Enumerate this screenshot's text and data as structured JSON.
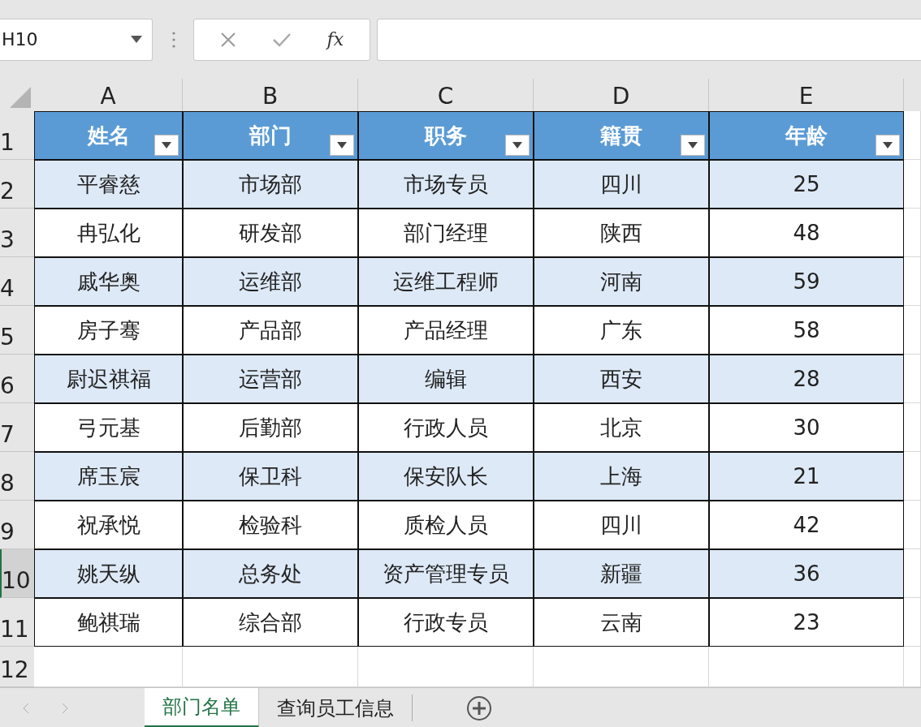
{
  "name_box": {
    "value": "H10"
  },
  "formula_bar": {
    "function_label": "fx"
  },
  "column_headers": [
    "A",
    "B",
    "C",
    "D",
    "E"
  ],
  "row_headers": [
    {
      "label": "1",
      "selected": false
    },
    {
      "label": "2",
      "selected": false
    },
    {
      "label": "3",
      "selected": false
    },
    {
      "label": "4",
      "selected": false
    },
    {
      "label": "5",
      "selected": false
    },
    {
      "label": "6",
      "selected": false
    },
    {
      "label": "7",
      "selected": false
    },
    {
      "label": "8",
      "selected": false
    },
    {
      "label": "9",
      "selected": false
    },
    {
      "label": "10",
      "selected": true
    },
    {
      "label": "11",
      "selected": false
    },
    {
      "label": "12",
      "selected": false
    }
  ],
  "table": {
    "columns": [
      "姓名",
      "部门",
      "职务",
      "籍贯",
      "年龄"
    ],
    "rows": [
      [
        "平睿慈",
        "市场部",
        "市场专员",
        "四川",
        "25"
      ],
      [
        "冉弘化",
        "研发部",
        "部门经理",
        "陕西",
        "48"
      ],
      [
        "戚华奥",
        "运维部",
        "运维工程师",
        "河南",
        "59"
      ],
      [
        "房子骞",
        "产品部",
        "产品经理",
        "广东",
        "58"
      ],
      [
        "尉迟祺福",
        "运营部",
        "编辑",
        "西安",
        "28"
      ],
      [
        "弓元基",
        "后勤部",
        "行政人员",
        "北京",
        "30"
      ],
      [
        "席玉宸",
        "保卫科",
        "保安队长",
        "上海",
        "21"
      ],
      [
        "祝承悦",
        "检验科",
        "质检人员",
        "四川",
        "42"
      ],
      [
        "姚天纵",
        "总务处",
        "资产管理专员",
        "新疆",
        "36"
      ],
      [
        "鲍祺瑞",
        "综合部",
        "行政专员",
        "云南",
        "23"
      ]
    ]
  },
  "sheet_tabs": [
    {
      "label": "部门名单",
      "selected": true
    },
    {
      "label": "查询员工信息",
      "selected": false
    }
  ]
}
